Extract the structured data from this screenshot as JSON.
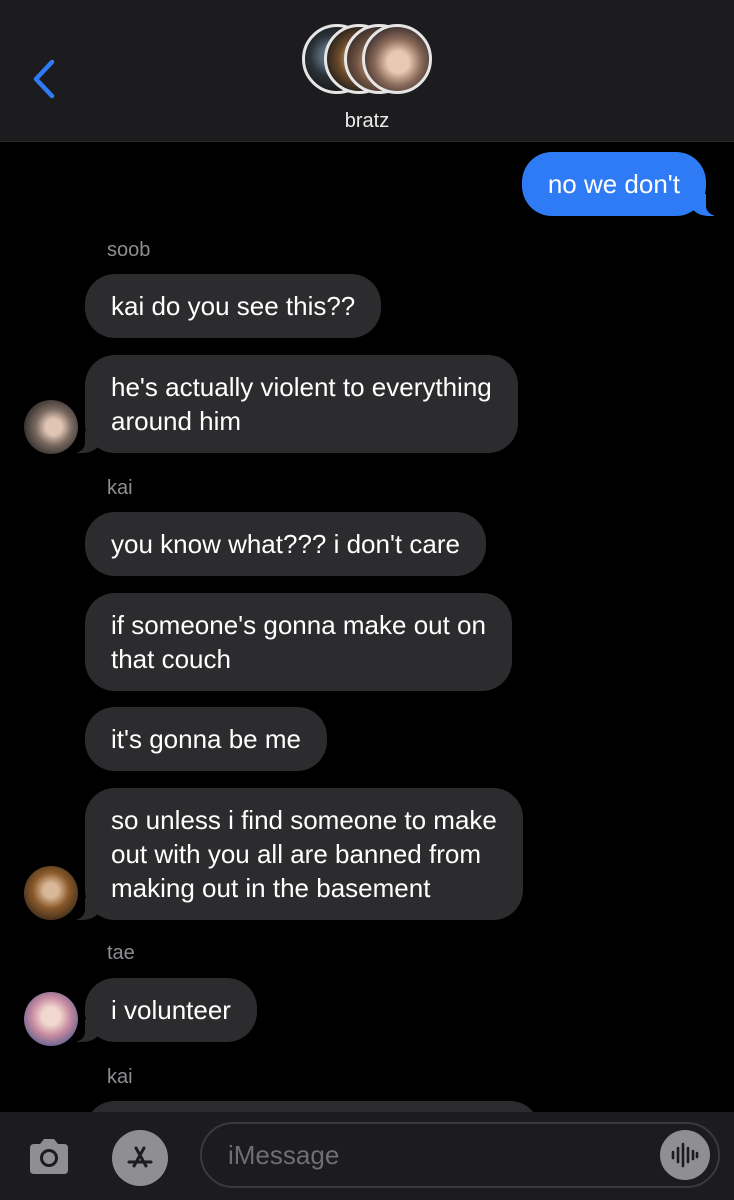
{
  "header": {
    "group_name": "bratz"
  },
  "messages": [
    {
      "type": "outgoing",
      "text": "no we don't"
    },
    {
      "type": "sender",
      "text": "soob"
    },
    {
      "type": "incoming",
      "text": "kai do you see this??"
    },
    {
      "type": "incoming",
      "lines": [
        "he's actually violent to everything",
        "around him"
      ]
    },
    {
      "type": "sender",
      "text": "kai"
    },
    {
      "type": "incoming",
      "text": "you know what??? i don't care"
    },
    {
      "type": "incoming",
      "lines": [
        "if someone's gonna make out on",
        "that couch"
      ]
    },
    {
      "type": "incoming",
      "text": "it's gonna be me"
    },
    {
      "type": "incoming",
      "lines": [
        "so unless i find someone to make",
        "out with you all are banned from",
        "making out in the basement"
      ]
    },
    {
      "type": "sender",
      "text": "tae"
    },
    {
      "type": "incoming",
      "text": "i volunteer"
    },
    {
      "type": "sender",
      "text": "kai"
    }
  ],
  "composer": {
    "placeholder": "iMessage"
  },
  "colors": {
    "background": "#000000",
    "header_bg": "#1c1c1e",
    "incoming_bubble": "#2c2c2e",
    "outgoing_bubble": "#2f7bf6",
    "accent": "#2f7bf6",
    "secondary_text": "#8e8e93"
  },
  "icons": {
    "back": "chevron-left-icon",
    "camera": "camera-icon",
    "apps": "app-store-icon",
    "audio": "waveform-icon"
  }
}
